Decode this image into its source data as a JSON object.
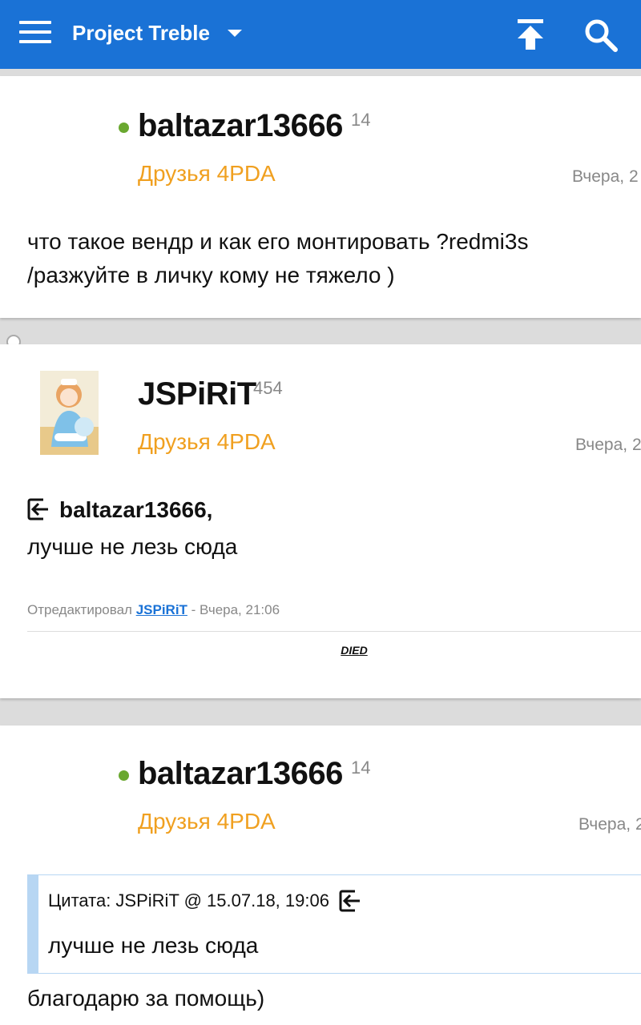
{
  "appbar": {
    "title": "Project Treble",
    "menu_icon": "menu-icon",
    "scroll_top_icon": "arrow-to-top-icon",
    "search_icon": "search-icon",
    "color": "#1a72d6"
  },
  "posts": [
    {
      "username": "baltazar13666",
      "reputation": "14",
      "group": "Друзья 4PDA",
      "date": "Вчера, 2",
      "online": true,
      "text_lines": [
        "что такое вендр и как его монтировать ?redmi3s",
        "/разжуйте в личку кому не тяжело )"
      ]
    },
    {
      "username": "JSPiRiT",
      "reputation": "454",
      "group": "Друзья 4PDA",
      "date": "Вчера, 2",
      "reply_to": "baltazar13666,",
      "text": "лучше не лезь сюда",
      "edited_prefix": "Отредактировал",
      "edited_by": "JSPiRiT",
      "edited_suffix": "- Вчера, 21:06",
      "signature": "DIED"
    },
    {
      "username": "baltazar13666",
      "reputation": "14",
      "group": "Друзья 4PDA",
      "date": "Вчера, 2",
      "online": true,
      "quote_header": "Цитата: JSPiRiT @ 15.07.18, 19:06",
      "quote_text": "лучше не лезь сюда",
      "text": "благодарю за помощь)"
    }
  ],
  "colors": {
    "group": "#f0a020",
    "online": "#6aa830",
    "link": "#1a72d6",
    "quote_border": "#b7d6f3"
  }
}
